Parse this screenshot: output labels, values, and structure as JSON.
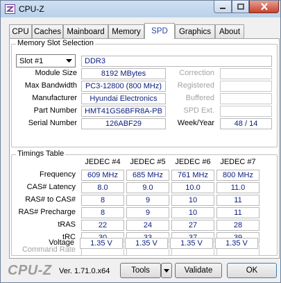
{
  "window": {
    "title": "CPU-Z"
  },
  "tabs": [
    "CPU",
    "Caches",
    "Mainboard",
    "Memory",
    "SPD",
    "Graphics",
    "About"
  ],
  "slot": {
    "group_title": "Memory Slot Selection",
    "selected": "Slot #1",
    "type": "DDR3",
    "labels": {
      "module_size": "Module Size",
      "max_bandwidth": "Max Bandwidth",
      "manufacturer": "Manufacturer",
      "part_number": "Part Number",
      "serial_number": "Serial Number",
      "correction": "Correction",
      "registered": "Registered",
      "buffered": "Buffered",
      "spd_ext": "SPD Ext.",
      "week_year": "Week/Year"
    },
    "values": {
      "module_size": "8192 MBytes",
      "max_bandwidth": "PC3-12800 (800 MHz)",
      "manufacturer": "Hyundai Electronics",
      "part_number": "HMT41GS6BFR8A-PB",
      "serial_number": "126ABF29",
      "week_year": "48 / 14"
    }
  },
  "timings": {
    "group_title": "Timings Table",
    "columns": [
      "JEDEC #4",
      "JEDEC #5",
      "JEDEC #6",
      "JEDEC #7"
    ],
    "rows": [
      {
        "label": "Frequency",
        "values": [
          "609 MHz",
          "685 MHz",
          "761 MHz",
          "800 MHz"
        ]
      },
      {
        "label": "CAS# Latency",
        "values": [
          "8.0",
          "9.0",
          "10.0",
          "11.0"
        ]
      },
      {
        "label": "RAS# to CAS#",
        "values": [
          "8",
          "9",
          "10",
          "11"
        ]
      },
      {
        "label": "RAS# Precharge",
        "values": [
          "8",
          "9",
          "10",
          "11"
        ]
      },
      {
        "label": "tRAS",
        "values": [
          "22",
          "24",
          "27",
          "28"
        ]
      },
      {
        "label": "tRC",
        "values": [
          "30",
          "33",
          "37",
          "39"
        ]
      },
      {
        "label": "Command Rate",
        "values": [
          "",
          "",
          "",
          ""
        ]
      },
      {
        "label": "Voltage",
        "values": [
          "1.35 V",
          "1.35 V",
          "1.35 V",
          "1.35 V"
        ]
      }
    ]
  },
  "footer": {
    "brand": "CPU-Z",
    "version": "Ver. 1.71.0.x64",
    "tools_label": "Tools",
    "validate_label": "Validate",
    "ok_label": "OK"
  }
}
